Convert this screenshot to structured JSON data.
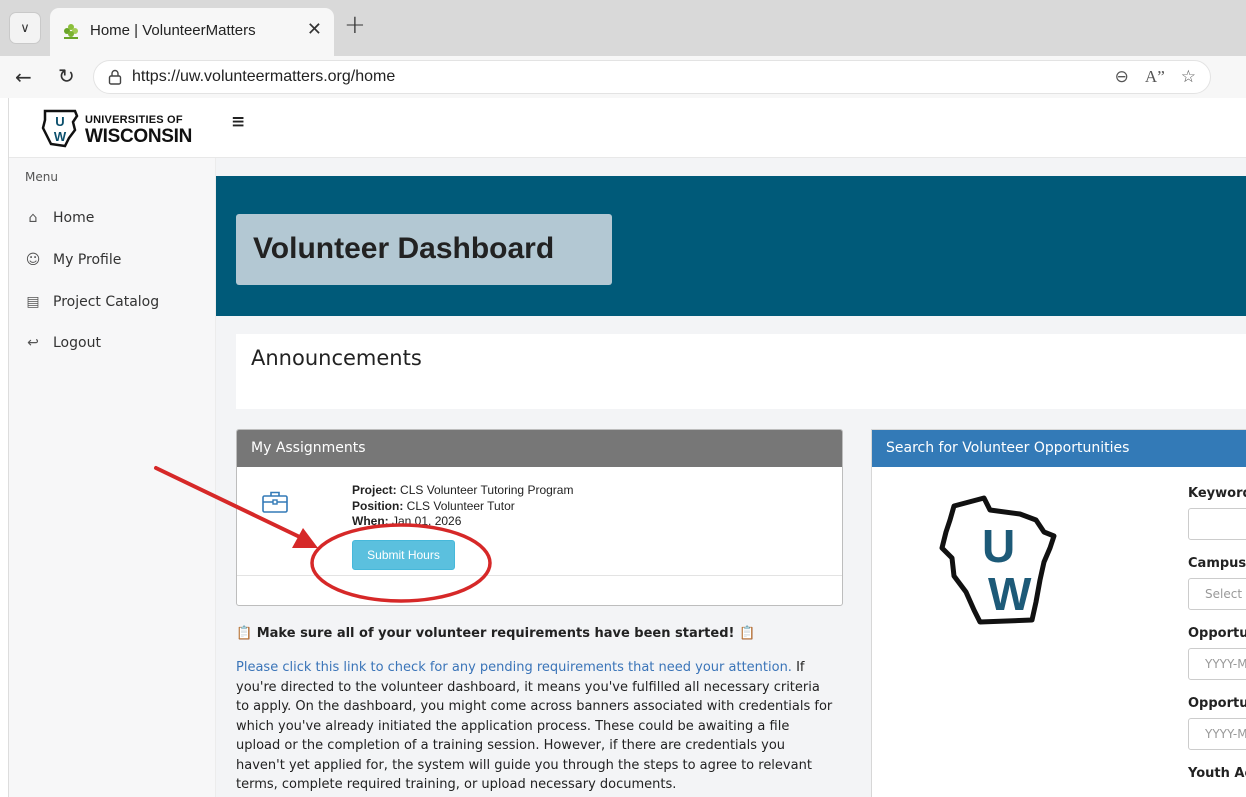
{
  "browser": {
    "tab_title": "Home | VolunteerMatters",
    "url": "https://uw.volunteermatters.org/home"
  },
  "header": {
    "logo_line1": "UNIVERSITIES OF",
    "logo_line2": "WISCONSIN",
    "logo_mark": "UW"
  },
  "sidebar": {
    "menu_label": "Menu",
    "items": [
      {
        "label": "Home",
        "icon": "home-icon"
      },
      {
        "label": "My Profile",
        "icon": "smiley-icon"
      },
      {
        "label": "Project Catalog",
        "icon": "book-icon"
      },
      {
        "label": "Logout",
        "icon": "logout-icon"
      }
    ]
  },
  "hero": {
    "title": "Volunteer Dashboard"
  },
  "announcements": {
    "title": "Announcements"
  },
  "assignments": {
    "title": "My Assignments",
    "project_label": "Project:",
    "project_value": "CLS Volunteer Tutoring Program",
    "position_label": "Position:",
    "position_value": "CLS Volunteer Tutor",
    "when_label": "When:",
    "when_value": "Jan 01, 2026",
    "submit_label": "Submit Hours"
  },
  "requirements": {
    "heading": "Make sure all of your volunteer requirements have been started!",
    "link_text": "Please click this link to check for any pending requirements that need your attention.",
    "body": "If you're directed to the volunteer dashboard, it means you've fulfilled all necessary criteria to apply. On the dashboard, you might come across banners associated with credentials for which you've already initiated the application process. These could be awaiting a file upload or the completion of a training session. However, if there are credentials you haven't yet applied for, the system will guide you through the steps to agree to relevant terms, complete required training, or upload necessary documents."
  },
  "search": {
    "title": "Search for Volunteer Opportunities",
    "logo_letter_top": "U",
    "logo_letter_bottom": "W",
    "keyword_label": "Keyword",
    "campus_label": "Campus",
    "campus_placeholder": "Select a campus",
    "opp_start_label": "Opportunity Start Date",
    "opp_start_placeholder": "YYYY-MM-DD",
    "opp_end_label": "Opportunity End Date",
    "opp_end_placeholder": "YYYY-MM-DD",
    "youth_label": "Youth Activity"
  },
  "colors": {
    "hero_bg": "#005a79",
    "hero_title_bg": "#b3c8d3",
    "assign_header": "#777777",
    "search_header": "#337ab7",
    "submit_button": "#5bc0de",
    "link": "#3a74b8",
    "annotation": "#d62828"
  }
}
